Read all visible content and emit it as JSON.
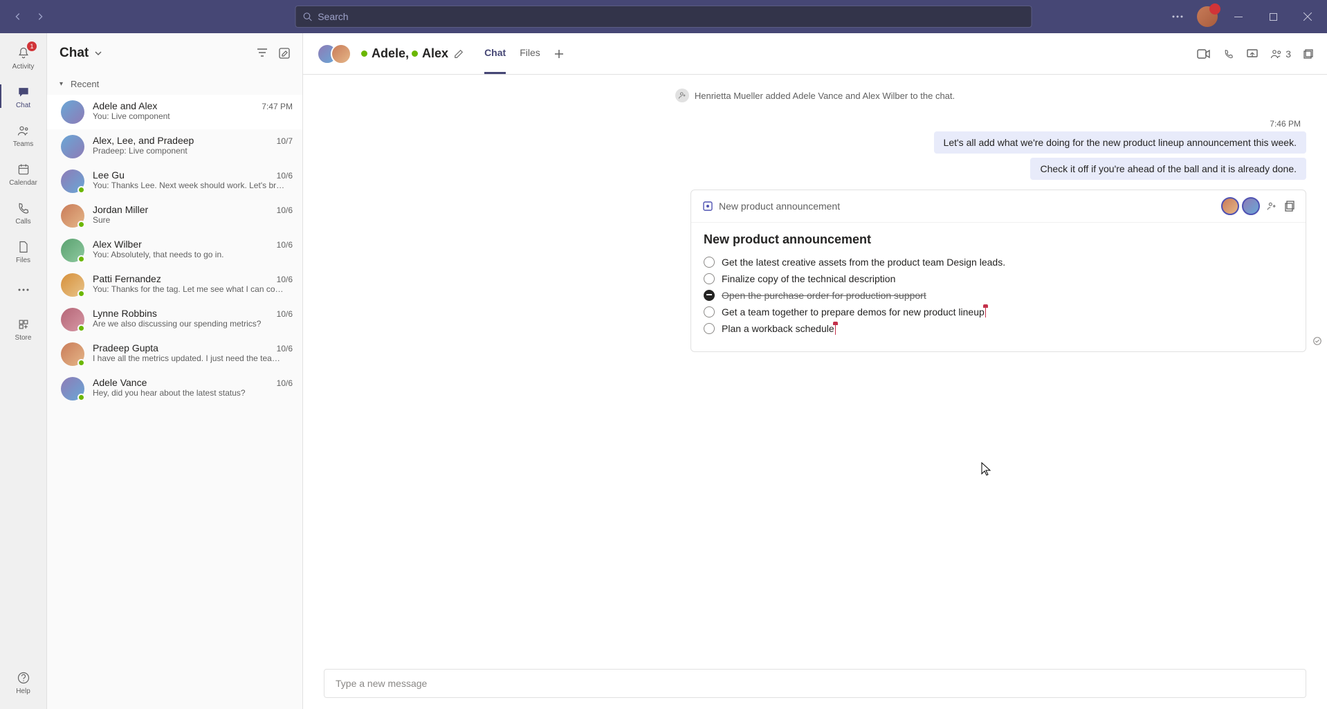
{
  "titlebar": {
    "search_placeholder": "Search",
    "profile_badge": ""
  },
  "rail": {
    "activity": "Activity",
    "activity_badge": "1",
    "chat": "Chat",
    "teams": "Teams",
    "calendar": "Calendar",
    "calls": "Calls",
    "files": "Files",
    "store": "Store",
    "help": "Help"
  },
  "chatlist": {
    "title": "Chat",
    "section_recent": "Recent",
    "items": [
      {
        "name": "Adele and Alex",
        "preview": "You: Live component",
        "time": "7:47 PM",
        "selected": true
      },
      {
        "name": "Alex, Lee, and Pradeep",
        "preview": "Pradeep: Live component",
        "time": "10/7"
      },
      {
        "name": "Lee Gu",
        "preview": "You: Thanks Lee. Next week should work. Let's br…",
        "time": "10/6"
      },
      {
        "name": "Jordan Miller",
        "preview": "Sure",
        "time": "10/6"
      },
      {
        "name": "Alex Wilber",
        "preview": "You: Absolutely, that needs to go in.",
        "time": "10/6"
      },
      {
        "name": "Patti Fernandez",
        "preview": "You: Thanks for the tag. Let me see what I can co…",
        "time": "10/6"
      },
      {
        "name": "Lynne Robbins",
        "preview": "Are we also discussing our spending metrics?",
        "time": "10/6"
      },
      {
        "name": "Pradeep Gupta",
        "preview": "I have all the metrics updated. I just need the tea…",
        "time": "10/6"
      },
      {
        "name": "Adele Vance",
        "preview": "Hey, did you hear about the latest status?",
        "time": "10/6"
      }
    ]
  },
  "chat": {
    "header_name_1": "Adele,",
    "header_name_2": "Alex",
    "tabs": {
      "chat": "Chat",
      "files": "Files"
    },
    "participants": "3",
    "system_msg": "Henrietta Mueller added Adele Vance and Alex Wilber to the chat.",
    "messages": [
      {
        "time": "7:46 PM",
        "text": "Let's all add what we're doing for the new product lineup announcement this week."
      },
      {
        "text": "Check it off if you're ahead of the ball and it is already done."
      }
    ],
    "live_component": {
      "breadcrumb": "New product announcement",
      "heading": "New product announcement",
      "items": [
        {
          "text": "Get the latest creative assets from the product team Design leads.",
          "checked": false
        },
        {
          "text": "Finalize copy of the technical description",
          "checked": false
        },
        {
          "text": "Open the purchase order for production support",
          "checked": true
        },
        {
          "text": "Get a team together to prepare demos for new product lineup",
          "checked": false,
          "cursor": true
        },
        {
          "text": "Plan a workback schedule",
          "checked": false,
          "cursor": true
        }
      ]
    }
  },
  "compose": {
    "placeholder": "Type a new message"
  }
}
